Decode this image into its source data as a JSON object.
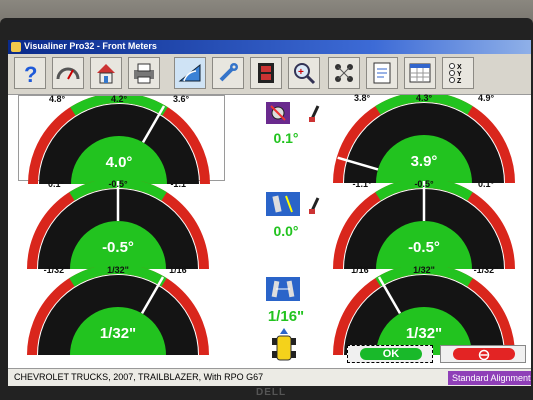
{
  "window": {
    "title": "Visualiner Pro32 - Front Meters"
  },
  "toolbar": {
    "buttons": [
      {
        "name": "help",
        "icon": "question-mark-icon"
      },
      {
        "name": "gauge",
        "icon": "speedometer-icon"
      },
      {
        "name": "home",
        "icon": "house-icon"
      },
      {
        "name": "print",
        "icon": "printer-icon"
      },
      {
        "name": "measure",
        "icon": "protractor-icon"
      },
      {
        "name": "tools",
        "icon": "wrench-icon"
      },
      {
        "name": "film",
        "icon": "film-strip-icon"
      },
      {
        "name": "zoom",
        "icon": "magnifier-icon"
      },
      {
        "name": "axles",
        "icon": "wheels-icon"
      },
      {
        "name": "report",
        "icon": "report-icon"
      },
      {
        "name": "spreadsheet",
        "icon": "spreadsheet-icon"
      },
      {
        "name": "xyz",
        "icon": "xyz-radio-icon"
      }
    ],
    "xyz_labels": [
      "X",
      "Y",
      "Z"
    ]
  },
  "meters": {
    "caster": {
      "left": {
        "min_label": "4.8°",
        "target_label": "4.2°",
        "max_label": "3.6°",
        "value": "4.0°",
        "reading": 4.0,
        "range": [
          4.8,
          3.6
        ]
      },
      "right": {
        "min_label": "3.8°",
        "target_label": "4.3°",
        "max_label": "4.9°",
        "value": "3.9°",
        "reading": 3.9,
        "range": [
          3.8,
          4.9
        ]
      },
      "cross_value": "0.1°"
    },
    "camber": {
      "left": {
        "min_label": "0.1°",
        "target_label": "-0.5°",
        "max_label": "-1.1°",
        "value": "-0.5°",
        "reading": -0.5,
        "range": [
          0.1,
          -1.1
        ]
      },
      "right": {
        "min_label": "-1.1°",
        "target_label": "-0.5°",
        "max_label": "0.1°",
        "value": "-0.5°",
        "reading": -0.5,
        "range": [
          -1.1,
          0.1
        ]
      },
      "cross_value": "0.0°"
    },
    "toe": {
      "left": {
        "min_label": "-1/32\"",
        "target_label": "1/32\"",
        "max_label": "1/16\"",
        "value": "1/32\"",
        "reading": 0.03125,
        "range": [
          -0.03125,
          0.0625
        ]
      },
      "right": {
        "min_label": "1/16\"",
        "target_label": "1/32\"",
        "max_label": "-1/32\"",
        "value": "1/32\"",
        "reading": 0.03125,
        "range": [
          0.0625,
          -0.03125
        ]
      },
      "total_value": "1/16\""
    }
  },
  "buttons": {
    "ok_label": "OK",
    "cancel_icon": "no-entry-icon"
  },
  "status": {
    "vehicle": "CHEVROLET TRUCKS, 2007, TRAILBLAZER, With RPO G67",
    "mode": "Standard Alignment"
  },
  "monitor": {
    "brand": "DELL"
  },
  "colors": {
    "in_spec": "#22c31f",
    "out_of_spec": "#d9261c",
    "gauge_bg": "#141414",
    "title_bar": "#0a2a8a",
    "mode_badge": "#8f3fb8"
  }
}
